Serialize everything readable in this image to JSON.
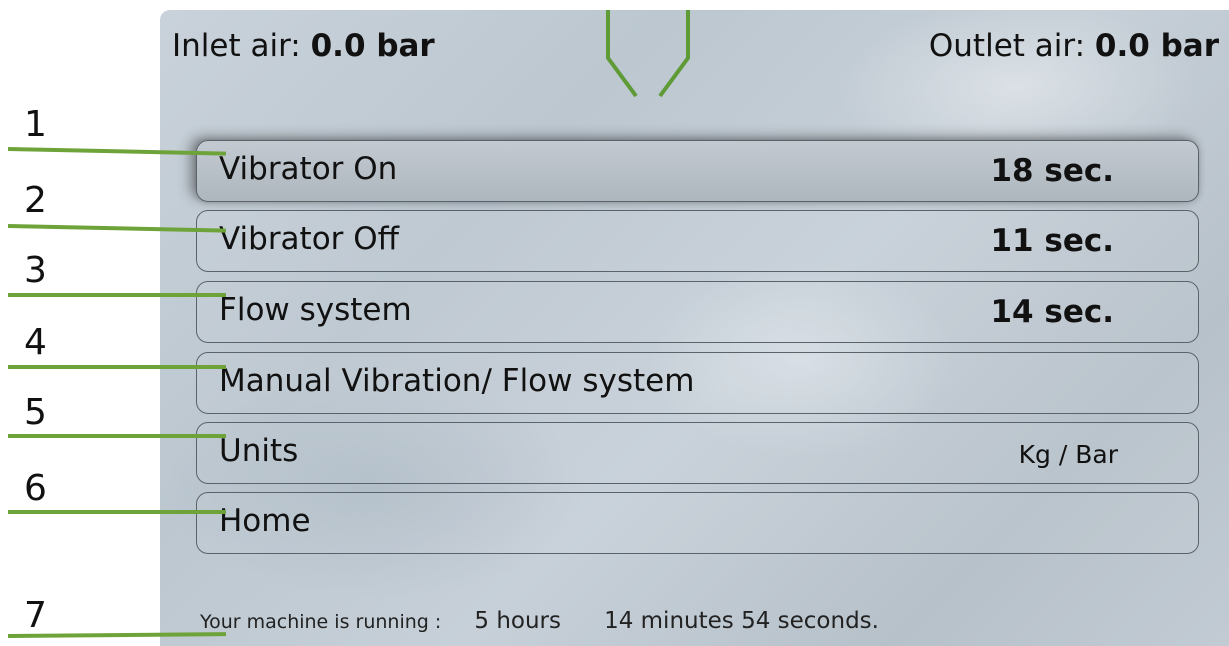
{
  "header": {
    "inlet_label": "Inlet air:",
    "inlet_value": "0.0 bar",
    "outlet_label": "Outlet air:",
    "outlet_value": "0.0 bar",
    "valve_icon": "valve-icon",
    "accent_color": "#6ea33a"
  },
  "menu": {
    "items": [
      {
        "label": "Vibrator On",
        "value": "18 sec.",
        "selected": true
      },
      {
        "label": "Vibrator Off",
        "value": "11 sec."
      },
      {
        "label": "Flow system",
        "value": "14 sec."
      },
      {
        "label": "Manual Vibration/ Flow system",
        "value": ""
      },
      {
        "label": "Units",
        "value": "Kg / Bar"
      },
      {
        "label": "Home",
        "value": ""
      }
    ]
  },
  "status": {
    "prefix": "Your machine is running :",
    "hours": "5 hours",
    "rest": "14 minutes 54 seconds."
  },
  "callouts": [
    "1",
    "2",
    "3",
    "4",
    "5",
    "6",
    "7"
  ]
}
